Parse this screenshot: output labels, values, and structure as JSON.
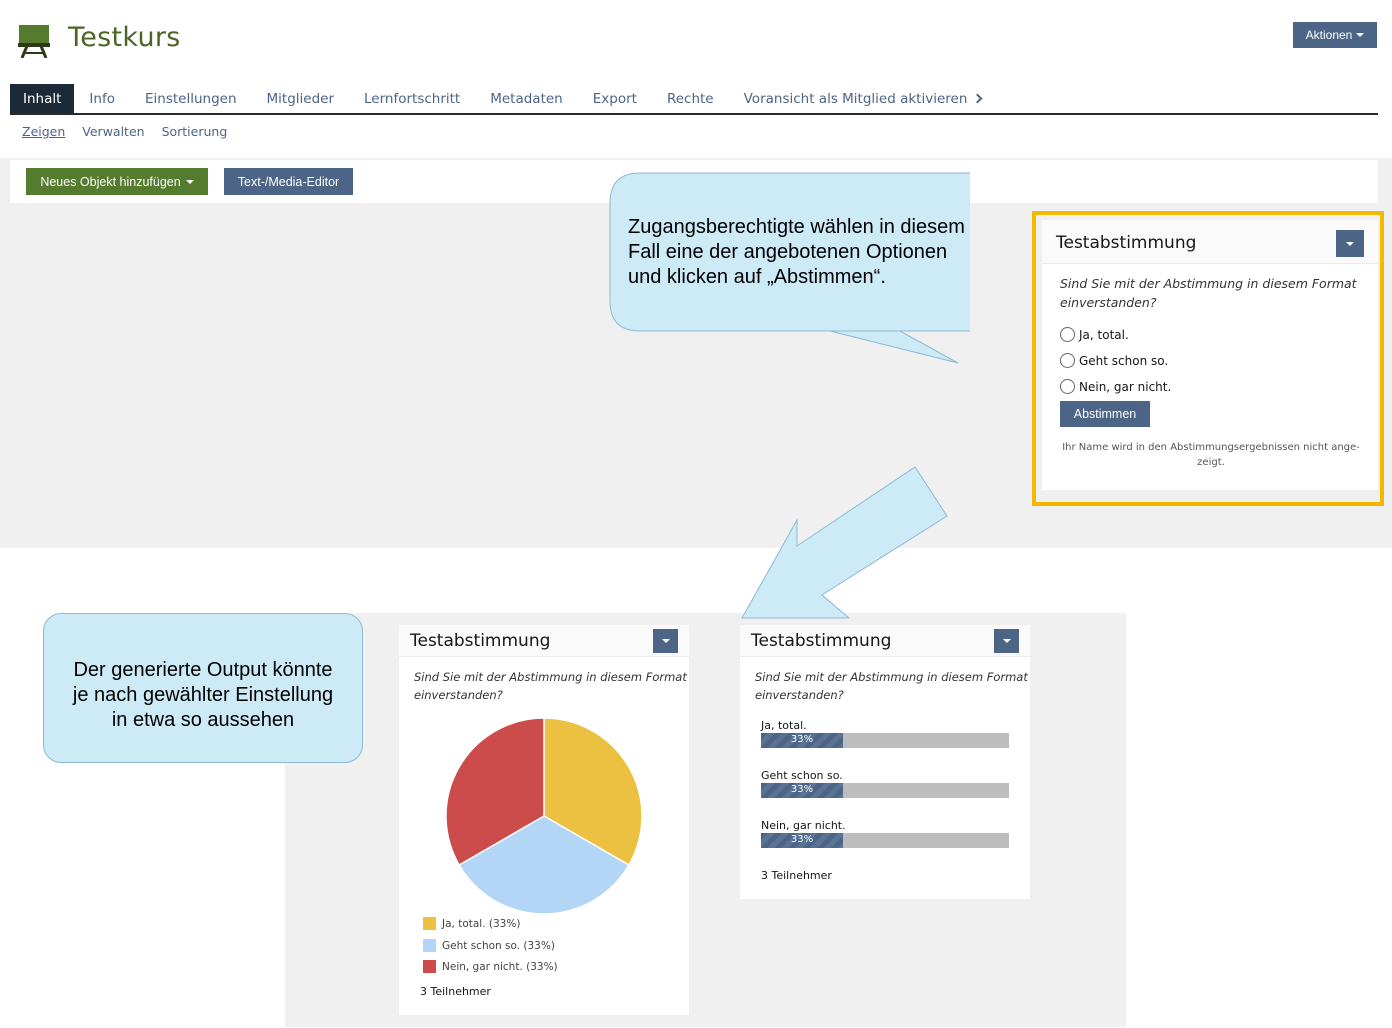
{
  "header": {
    "course_title": "Testkurs",
    "actions_label": "Aktionen"
  },
  "tabs": [
    {
      "label": "Inhalt",
      "active": true
    },
    {
      "label": "Info"
    },
    {
      "label": "Einstellungen"
    },
    {
      "label": "Mitglieder"
    },
    {
      "label": "Lernfortschritt"
    },
    {
      "label": "Metadaten"
    },
    {
      "label": "Export"
    },
    {
      "label": "Rechte"
    },
    {
      "label": "Voransicht als Mitglied aktivieren"
    }
  ],
  "subtabs": [
    {
      "label": "Zeigen",
      "active": true
    },
    {
      "label": "Verwalten"
    },
    {
      "label": "Sortierung"
    }
  ],
  "toolbar": {
    "add_object_label": "Neues Objekt hinzufügen",
    "editor_label": "Text-/Media-Editor"
  },
  "poll": {
    "title": "Testabstimmung",
    "question_line1": "Sind Sie mit der Abstimmung in diesem Format",
    "question_line2": "einverstanden?",
    "options": [
      "Ja, total.",
      "Geht schon so.",
      "Nein, gar nicht."
    ],
    "vote_label": "Abstimmen",
    "anon_note_line1": "Ihr Name wird in den Abstimmungsergebnissen nicht ange-",
    "anon_note_line2": "zeigt."
  },
  "callouts": {
    "top_line1": "Zugangsberechtigte wählen in diesem",
    "top_line2": "Fall eine der angebotenen Optionen",
    "top_line3": "und klicken auf „Abstimmen“.",
    "bottom_line1": "Der generierte Output könnte",
    "bottom_line2": "je nach gewählter Einstellung",
    "bottom_line3": "in etwa so aussehen"
  },
  "results": {
    "participants_label": "3 Teilnehmer",
    "legend": [
      "Ja, total. (33%)",
      "Geht schon so. (33%)",
      "Nein, gar nicht. (33%)"
    ],
    "bar_labels": [
      "Ja, total.",
      "Geht schon so.",
      "Nein, gar nicht."
    ],
    "bar_pct_labels": [
      "33%",
      "33%",
      "33%"
    ]
  },
  "colors": {
    "brand_green": "#557b2e",
    "accent_blue": "#4c6586",
    "highlight": "#f5b800",
    "callout_fill": "#cdeaf7",
    "pie_yellow": "#ecc142",
    "pie_blue": "#b3d6f6",
    "pie_red": "#cc4b4b"
  },
  "chart_data": [
    {
      "type": "pie",
      "categories": [
        "Ja, total.",
        "Geht schon so.",
        "Nein, gar nicht."
      ],
      "values": [
        33,
        33,
        33
      ],
      "colors": [
        "#ecc142",
        "#b3d6f6",
        "#cc4b4b"
      ],
      "legend": "bottom"
    },
    {
      "type": "bar",
      "orientation": "horizontal",
      "categories": [
        "Ja, total.",
        "Geht schon so.",
        "Nein, gar nicht."
      ],
      "values": [
        33,
        33,
        33
      ],
      "ylim": [
        0,
        100
      ]
    }
  ]
}
